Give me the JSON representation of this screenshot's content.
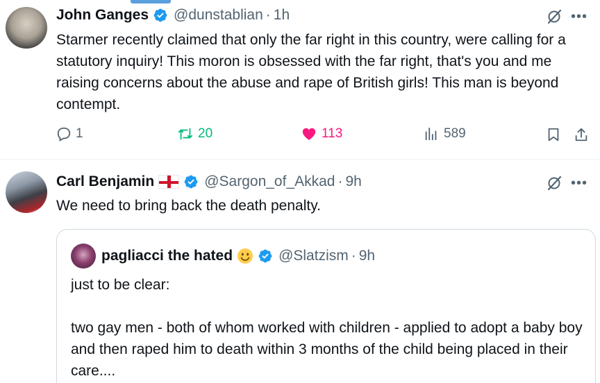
{
  "tweet1": {
    "author_name": "John Ganges",
    "handle": "@dunstablian",
    "separator": "·",
    "time": "1h",
    "text": "Starmer recently claimed that only the far right in this country, were calling for a statutory inquiry! This moron is obsessed with the far right, that's you and me raising concerns about the abuse and rape of British girls! This man is beyond contempt.",
    "stats": {
      "replies": "1",
      "retweets": "20",
      "likes": "113",
      "views": "589"
    },
    "more_label": "•••"
  },
  "tweet2": {
    "author_name": "Carl Benjamin",
    "handle": "@Sargon_of_Akkad",
    "separator": "·",
    "time": "9h",
    "text": "We need to bring back the death penalty.",
    "more_label": "•••"
  },
  "quote": {
    "author_name": "pagliacci the hated",
    "handle": "@Slatzism",
    "separator": "·",
    "time": "9h",
    "lines": [
      "just to be clear:",
      "",
      "two gay men - both of whom worked with children - applied to adopt a baby boy and then raped him to death within 3 months of the child being placed in their care...."
    ]
  },
  "colors": {
    "verified": "#1d9bf0",
    "retweet": "#00ba7c",
    "like": "#f91880",
    "muted": "#536471",
    "border": "#cfd9de"
  },
  "icons": [
    "verified-badge-icon",
    "england-flag-icon",
    "grok-icon",
    "more-icon",
    "reply-icon",
    "retweet-icon",
    "like-icon",
    "views-icon",
    "bookmark-icon",
    "share-icon",
    "smiley-emoji-icon"
  ]
}
